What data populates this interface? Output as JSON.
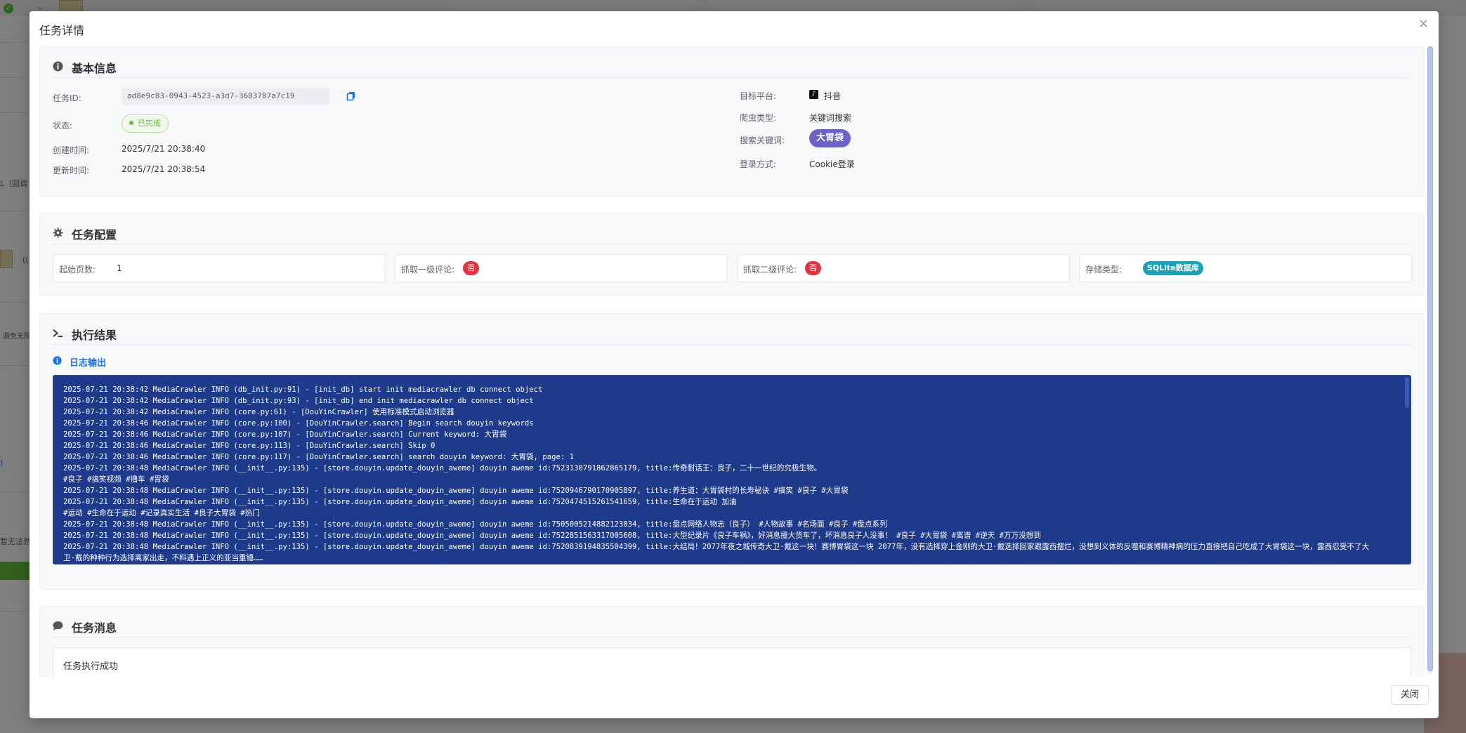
{
  "background": {
    "left_texts": [
      "L（回调",
      "避免无限",
      "暂无法然",
      ")"
    ],
    "avatar_hint": "(("
  },
  "dialog": {
    "title": "任务详情",
    "close_icon": "×",
    "footer_close_label": "关闭"
  },
  "basic_info": {
    "title": "基本信息",
    "task_id_label": "任务ID:",
    "task_id_value": "ad8e9c83-0943-4523-a3d7-3603787a7c19",
    "status_label": "状态:",
    "status_value": "已完成",
    "created_label": "创建时间:",
    "created_value": "2025/7/21 20:38:40",
    "updated_label": "更新时间:",
    "updated_value": "2025/7/21 20:38:54",
    "platform_label": "目标平台:",
    "platform_value": "抖音",
    "crawler_type_label": "爬虫类型:",
    "crawler_type_value": "关键词搜索",
    "keyword_label": "搜索关键词:",
    "keyword_value": "大胃袋",
    "login_label": "登录方式:",
    "login_value": "Cookie登录"
  },
  "task_config": {
    "title": "任务配置",
    "start_page_label": "起始页数:",
    "start_page_value": "1",
    "first_comment_label": "抓取一级评论:",
    "first_comment_value": "否",
    "second_comment_label": "抓取二级评论:",
    "second_comment_value": "否",
    "storage_label": "存储类型:",
    "storage_value": "SQLite数据库"
  },
  "result": {
    "title": "执行结果",
    "log_title": "日志输出",
    "log_lines": [
      "2025-07-21 20:38:42 MediaCrawler INFO (db_init.py:91) - [init_db] start init mediacrawler db connect object",
      "2025-07-21 20:38:42 MediaCrawler INFO (db_init.py:93) - [init_db] end init mediacrawler db connect object",
      "2025-07-21 20:38:42 MediaCrawler INFO (core.py:61) - [DouYinCrawler] 使用标准模式启动浏览器",
      "2025-07-21 20:38:46 MediaCrawler INFO (core.py:100) - [DouYinCrawler.search] Begin search douyin keywords",
      "2025-07-21 20:38:46 MediaCrawler INFO (core.py:107) - [DouYinCrawler.search] Current keyword: 大胃袋",
      "2025-07-21 20:38:46 MediaCrawler INFO (core.py:113) - [DouYinCrawler.search] Skip 0",
      "2025-07-21 20:38:46 MediaCrawler INFO (core.py:117) - [DouYinCrawler.search] search douyin keyword: 大胃袋, page: 1",
      "2025-07-21 20:38:48 MediaCrawler INFO (__init__.py:135) - [store.douyin.update_douyin_aweme] douyin aweme id:7523130791862865179, title:传奇耐话王：良子，二十一世纪的究极生物。",
      "#良子 #搞笑视频 #撸车 #胃袋",
      "2025-07-21 20:38:48 MediaCrawler INFO (__init__.py:135) - [store.douyin.update_douyin_aweme] douyin aweme id:7520946790170905897, title:养生道：大胃袋村的长寿秘诀 #搞笑 #良子 #大胃袋",
      "2025-07-21 20:38:48 MediaCrawler INFO (__init__.py:135) - [store.douyin.update_douyin_aweme] douyin aweme id:7520474515261541659, title:生命在于运动 加油",
      "#运动 #生命在于运动 #记录真实生活 #良子大胃袋 #热门",
      "2025-07-21 20:38:48 MediaCrawler INFO (__init__.py:135) - [store.douyin.update_douyin_aweme] douyin aweme id:7505005214882123034, title:盘点网络人物志（良子） #人物故事 #名场面 #良子 #盘点系列",
      "2025-07-21 20:38:48 MediaCrawler INFO (__init__.py:135) - [store.douyin.update_douyin_aweme] douyin aweme id:7522851563317005608, title:大型纪录片《良子车祸》，好消息撞大货车了，坏消息良子人没事！ #良子 #大胃袋 #离谱 #逆天 #万万没想到",
      "2025-07-21 20:38:48 MediaCrawler INFO (__init__.py:135) - [store.douyin.update_douyin_aweme] douyin aweme id:7520839194835504399, title:大结局！2077年夜之城传奇大卫·戴这一块！赛博胃袋这一块 2077年，没有选择穿上金刚的大卫·戴选择回家跟露西摆烂，没想到义体的反噬和赛博精神病的压力直接把自己吃成了大胃袋这一块，露西忍受不了大",
      "卫·戴的种种行为选择离家出走，不料遇上正义的亚当重锤……"
    ]
  },
  "message": {
    "title": "任务消息",
    "text": "任务执行成功"
  }
}
